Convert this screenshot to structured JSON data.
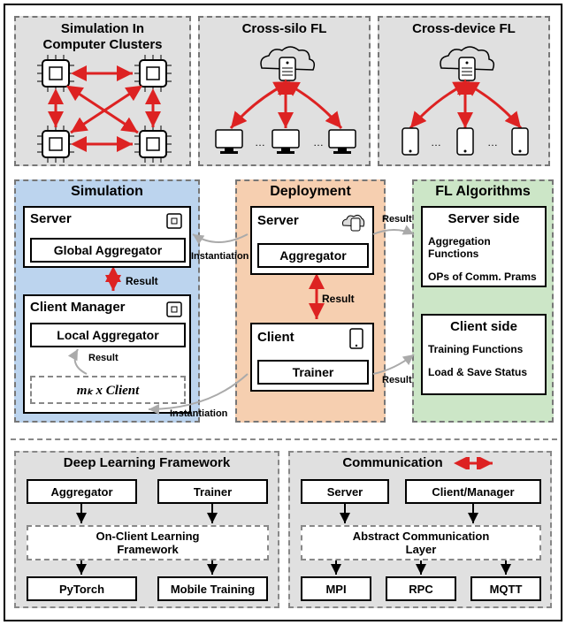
{
  "top": {
    "sim": {
      "title": "Simulation In\nComputer Clusters"
    },
    "silo": {
      "title": "Cross-silo FL"
    },
    "device": {
      "title": "Cross-device FL"
    }
  },
  "mid": {
    "simulation": {
      "title": "Simulation",
      "server": "Server",
      "globalAgg": "Global Aggregator",
      "clientMgr": "Client Manager",
      "localAgg": "Local Aggregator",
      "mkClient": "mₖ x Client",
      "resultLabel": "Result",
      "resultLabel2": "Result"
    },
    "deployment": {
      "title": "Deployment",
      "server": "Server",
      "agg": "Aggregator",
      "client": "Client",
      "trainer": "Trainer",
      "resultLabel": "Result"
    },
    "alg": {
      "title": "FL Algorithms",
      "serverSide": "Server side",
      "aggFn": "Aggregation Functions",
      "ops": "OPs of Comm. Prams",
      "clientSide": "Client side",
      "trainFn": "Training Functions",
      "loadSave": "Load & Save Status"
    },
    "instantiation1": "Instantiation",
    "instantiation2": "Instantiation",
    "result1": "Result",
    "result2": "Result"
  },
  "bottom": {
    "dl": {
      "title": "Deep Learning Framework",
      "agg": "Aggregator",
      "trainer": "Trainer",
      "onclient": "On-Client Learning\nFramework",
      "pytorch": "PyTorch",
      "mobile": "Mobile Training"
    },
    "comm": {
      "title": "Communication",
      "server": "Server",
      "cm": "Client/Manager",
      "abs": "Abstract Communication\nLayer",
      "mpi": "MPI",
      "rpc": "RPC",
      "mqtt": "MQTT"
    }
  }
}
